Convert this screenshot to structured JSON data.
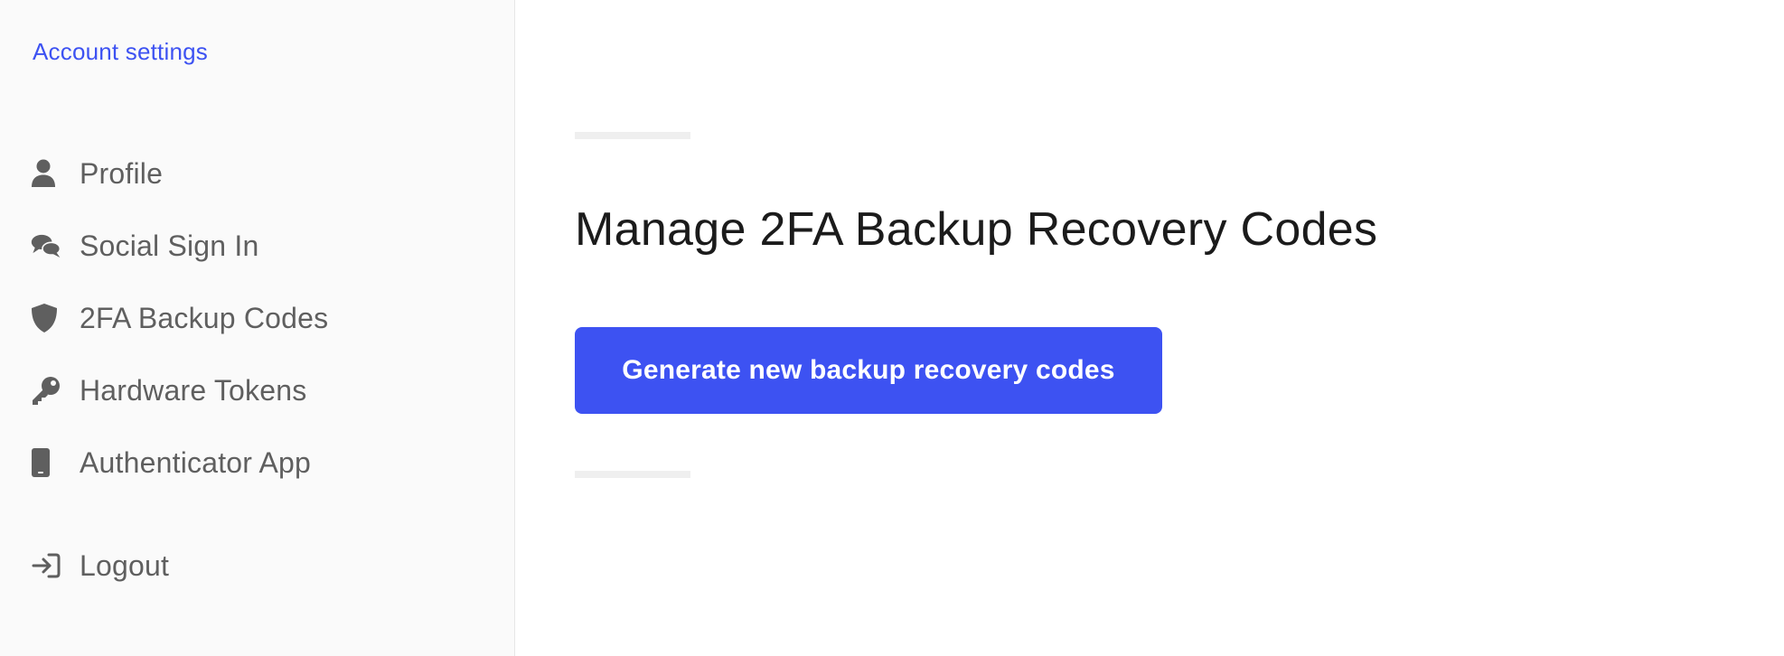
{
  "sidebar": {
    "title": "Account settings",
    "items": [
      {
        "label": "Profile",
        "icon": "user-icon"
      },
      {
        "label": "Social Sign In",
        "icon": "chat-bubbles-icon"
      },
      {
        "label": "2FA Backup Codes",
        "icon": "shield-icon"
      },
      {
        "label": "Hardware Tokens",
        "icon": "key-icon"
      },
      {
        "label": "Authenticator App",
        "icon": "mobile-phone-icon"
      }
    ],
    "logout": {
      "label": "Logout",
      "icon": "sign-in-arrow-icon"
    }
  },
  "main": {
    "title": "Manage 2FA Backup Recovery Codes",
    "button_label": "Generate new backup recovery codes"
  },
  "colors": {
    "accent": "#3d52f2",
    "sidebar_bg": "#fafafa",
    "nav_text": "#5f5f5f",
    "heading_text": "#1b1b1b"
  }
}
